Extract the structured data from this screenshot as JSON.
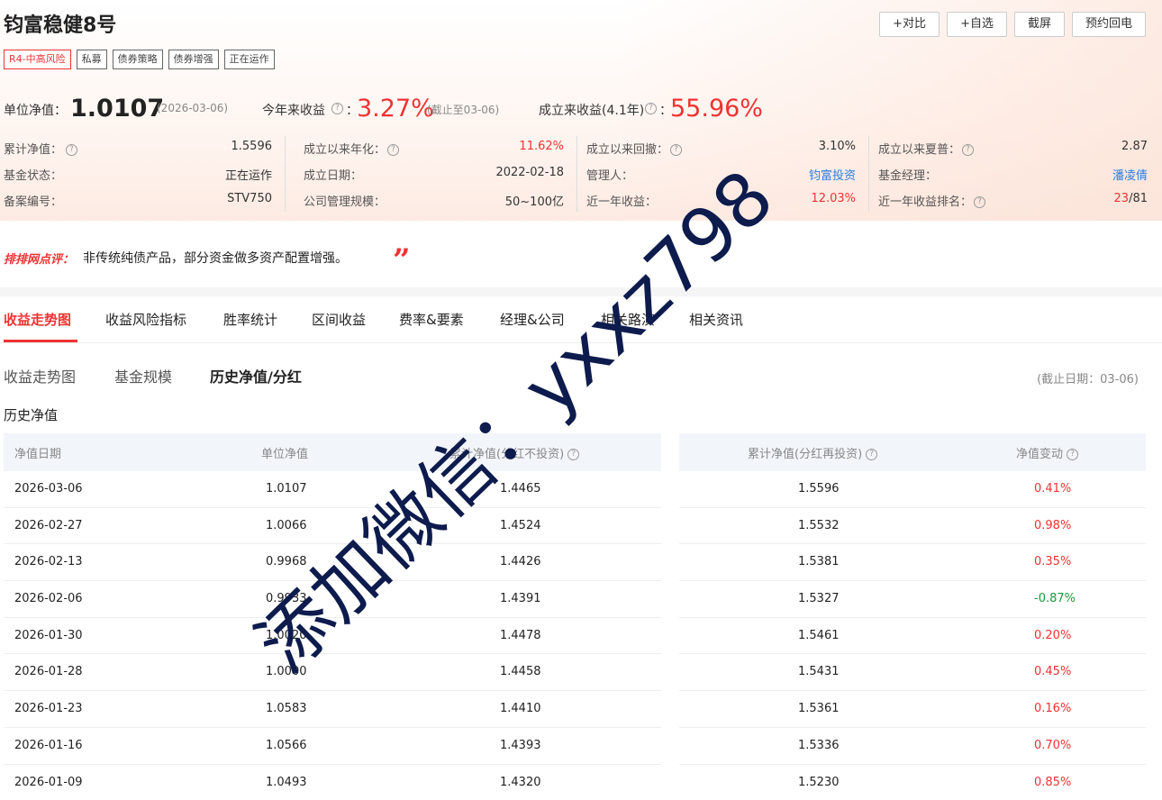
{
  "fund": {
    "title": "钧富稳健8号",
    "tags": [
      "R4-中高风险",
      "私募",
      "债券策略",
      "债券增强",
      "正在运作"
    ]
  },
  "toolbar": {
    "compare": "+对比",
    "watch": "+自选",
    "screenshot": "截屏",
    "roadshow": "预约回电"
  },
  "nav": {
    "unit_nav_label": "单位净值：",
    "unit_nav_value": "1.0107",
    "unit_nav_date": "(2026-03-06)",
    "ytd_label": "今年来收益",
    "ytd_value": "3.27%",
    "ytd_note": "(截止至03-06)",
    "since_label": "成立来收益(4.1年)",
    "since_value": "55.96%",
    "colon": "："
  },
  "info": {
    "col1": [
      {
        "k": "累计净值：",
        "v": "1.5596"
      },
      {
        "k": "基金状态：",
        "v": "正在运作"
      },
      {
        "k": "备案编号：",
        "v": "STV750"
      }
    ],
    "col2": [
      {
        "k": "成立以来年化：",
        "v": "11.62%"
      },
      {
        "k": "成立日期：",
        "v": "2022-02-18"
      },
      {
        "k": "公司管理规模：",
        "v": "50~100亿"
      }
    ],
    "col3": [
      {
        "k": "成立以来回撤：",
        "v": "3.10%"
      },
      {
        "k": "管理人：",
        "v": "钧富投资"
      },
      {
        "k": "近一年收益：",
        "v": "12.03%"
      }
    ],
    "col4": [
      {
        "k": "成立以来夏普：",
        "v": "2.87"
      },
      {
        "k": "基金经理：",
        "v": "潘凌倩"
      },
      {
        "k": "近一年收益排名：",
        "v_red": "23",
        "v_rest": "/81"
      }
    ]
  },
  "comment": {
    "brand": "排排网点评：",
    "text": "非传统纯债产品，部分资金做多资产配置增强。",
    "quote": "”"
  },
  "tabs": [
    "收益走势图",
    "收益风险指标",
    "胜率统计",
    "区间收益",
    "费率&要素",
    "经理&公司",
    "相关路演",
    "相关资讯"
  ],
  "subtabs": [
    "收益走势图",
    "基金规模",
    "历史净值/分红"
  ],
  "cutoff": "(截止日期：03-06)",
  "section_title": "历史净值",
  "table": {
    "headers": [
      "净值日期",
      "单位净值",
      "累计净值(分红不投资)",
      "累计净值(分红再投资)",
      "净值变动"
    ],
    "rows": [
      {
        "date": "2026-03-06",
        "unit": "1.0107",
        "cum_no": "1.4465",
        "cum_re": "1.5596",
        "chg": "0.41%",
        "dir": "up"
      },
      {
        "date": "2026-02-27",
        "unit": "1.0066",
        "cum_no": "1.4524",
        "cum_re": "1.5532",
        "chg": "0.98%",
        "dir": "up"
      },
      {
        "date": "2026-02-13",
        "unit": "0.9968",
        "cum_no": "1.4426",
        "cum_re": "1.5381",
        "chg": "0.35%",
        "dir": "up"
      },
      {
        "date": "2026-02-06",
        "unit": "0.9933",
        "cum_no": "1.4391",
        "cum_re": "1.5327",
        "chg": "-0.87%",
        "dir": "down"
      },
      {
        "date": "2026-01-30",
        "unit": "1.0020",
        "cum_no": "1.4478",
        "cum_re": "1.5461",
        "chg": "0.20%",
        "dir": "up"
      },
      {
        "date": "2026-01-28",
        "unit": "1.0000",
        "cum_no": "1.4458",
        "cum_re": "1.5431",
        "chg": "0.45%",
        "dir": "up"
      },
      {
        "date": "2026-01-23",
        "unit": "1.0583",
        "cum_no": "1.4410",
        "cum_re": "1.5361",
        "chg": "0.16%",
        "dir": "up"
      },
      {
        "date": "2026-01-16",
        "unit": "1.0566",
        "cum_no": "1.4393",
        "cum_re": "1.5336",
        "chg": "0.70%",
        "dir": "up"
      },
      {
        "date": "2026-01-09",
        "unit": "1.0493",
        "cum_no": "1.4320",
        "cum_re": "1.5230",
        "chg": "0.85%",
        "dir": "up"
      }
    ]
  },
  "watermark": "添加微信：yxxz798",
  "colors": {
    "red": "#e33333",
    "green": "#1a9a3a",
    "blue": "#2a7de1",
    "watermark": "#0d1b4d"
  }
}
